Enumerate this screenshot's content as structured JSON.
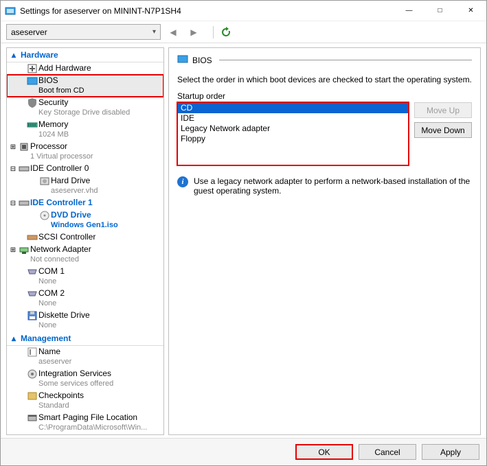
{
  "window": {
    "title": "Settings for aseserver on MININT-N7P1SH4",
    "minimize": "—",
    "maximize": "□",
    "close": "✕"
  },
  "toolbar": {
    "vm_selector": "aseserver"
  },
  "tree": {
    "sections": {
      "hardware": "Hardware",
      "management": "Management"
    },
    "items": {
      "add_hardware": "Add Hardware",
      "bios": {
        "label": "BIOS",
        "sub": "Boot from CD"
      },
      "security": {
        "label": "Security",
        "sub": "Key Storage Drive disabled"
      },
      "memory": {
        "label": "Memory",
        "sub": "1024 MB"
      },
      "processor": {
        "label": "Processor",
        "sub": "1 Virtual processor"
      },
      "ide0": "IDE Controller 0",
      "harddrive": {
        "label": "Hard Drive",
        "sub": "aseserver.vhd"
      },
      "ide1": "IDE Controller 1",
      "dvd": {
        "label": "DVD Drive",
        "sub": "Windows Gen1.iso"
      },
      "scsi": "SCSI Controller",
      "netadapter": {
        "label": "Network Adapter",
        "sub": "Not connected"
      },
      "com1": {
        "label": "COM 1",
        "sub": "None"
      },
      "com2": {
        "label": "COM 2",
        "sub": "None"
      },
      "diskette": {
        "label": "Diskette Drive",
        "sub": "None"
      },
      "name": {
        "label": "Name",
        "sub": "aseserver"
      },
      "integration": {
        "label": "Integration Services",
        "sub": "Some services offered"
      },
      "checkpoints": {
        "label": "Checkpoints",
        "sub": "Standard"
      },
      "paging": {
        "label": "Smart Paging File Location",
        "sub": "C:\\ProgramData\\Microsoft\\Win..."
      }
    }
  },
  "right": {
    "title": "BIOS",
    "desc": "Select the order in which boot devices are checked to start the operating system.",
    "startup_label": "Startup order",
    "startup_items": {
      "0": "CD",
      "1": "IDE",
      "2": "Legacy Network adapter",
      "3": "Floppy"
    },
    "moveup": "Move Up",
    "movedown": "Move Down",
    "info": "Use a legacy network adapter to perform a network-based installation of the guest operating system."
  },
  "footer": {
    "ok": "OK",
    "cancel": "Cancel",
    "apply": "Apply"
  }
}
